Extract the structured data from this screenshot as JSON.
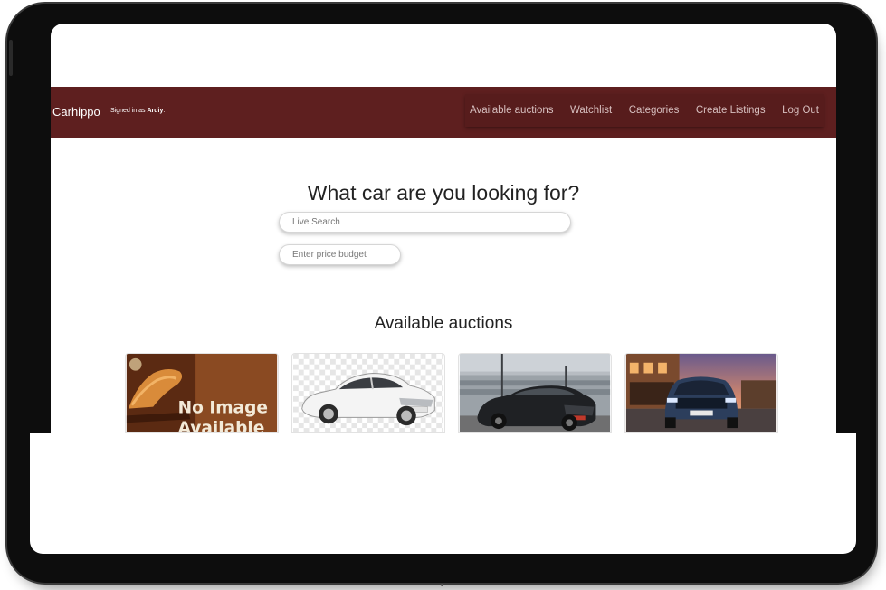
{
  "navbar": {
    "brand": "Carhippo",
    "signed_prefix": "Signed in as",
    "username": "Ardiy",
    "links": [
      "Available auctions",
      "Watchlist",
      "Categories",
      "Create Listings",
      "Log Out"
    ]
  },
  "hero": {
    "title": "What car are you looking for?",
    "search_placeholder": "Live Search",
    "budget_placeholder": "Enter price budget"
  },
  "auctions": {
    "title": "Available auctions",
    "no_image_line1": "No Image",
    "no_image_line2": "Available"
  },
  "colors": {
    "navbar": "#5e1f1f",
    "nav_link": "#d7bfbf",
    "no_image_bg": "#7a3e1c"
  }
}
